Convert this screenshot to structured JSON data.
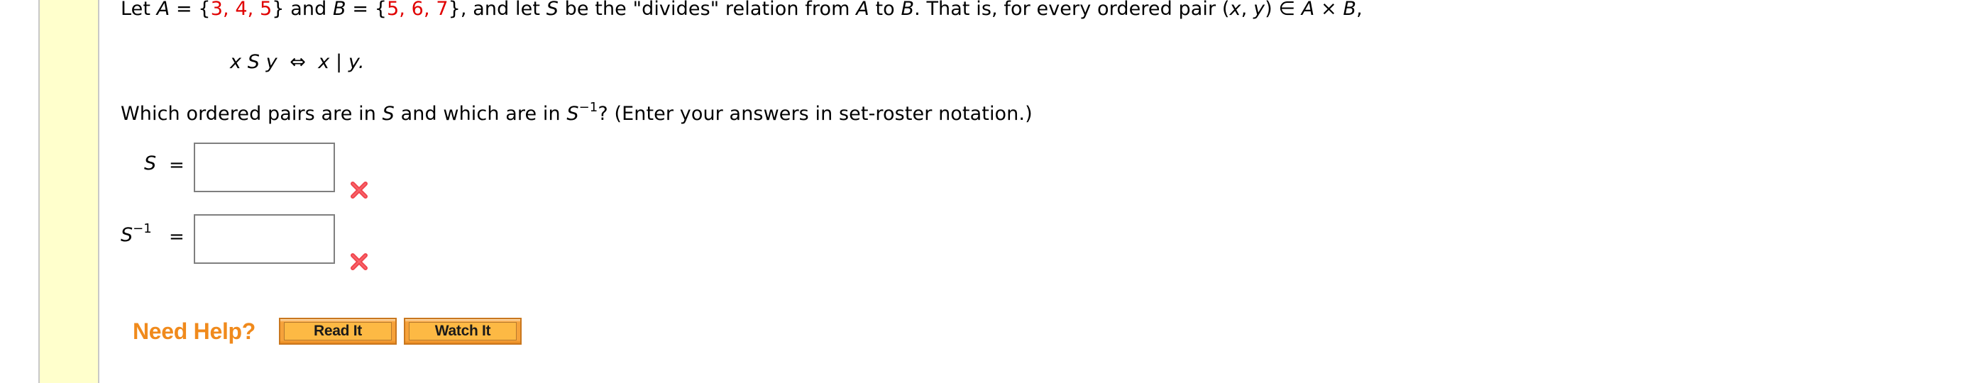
{
  "problem": {
    "line1": {
      "let": "Let ",
      "A": "A",
      "eq1": " = {",
      "A_elements": "3, 4, 5",
      "close1": "} and ",
      "B": "B",
      "eq2": " = {",
      "B_elements": "5, 6, 7",
      "close2": "}, and let ",
      "S": "S",
      "rest1": " be the \"divides\" relation from ",
      "A2": "A",
      "to": " to ",
      "B2": "B",
      "rest2": ". That is, for every ordered pair (",
      "x": "x",
      "comma": ", ",
      "y": "y",
      "rest3": ") ∈ ",
      "A3": "A",
      "times": " × ",
      "B3": "B",
      "end": ","
    },
    "definition": {
      "lhs": "x S y",
      "iff": "⇔",
      "rhs": "x | y."
    },
    "question": {
      "part1": "Which ordered pairs are in ",
      "S": "S",
      "part2": " and which are in ",
      "S2": "S",
      "exponent": "−1",
      "part3": "? (Enter your answers in set-roster notation.)"
    }
  },
  "answers": [
    {
      "label": "S",
      "exponent": "",
      "equals": "=",
      "value": "",
      "status": "incorrect",
      "status_icon": "x-mark-icon"
    },
    {
      "label": "S",
      "exponent": "−1",
      "equals": "=",
      "value": "",
      "status": "incorrect",
      "status_icon": "x-mark-icon"
    }
  ],
  "help": {
    "label": "Need Help?",
    "buttons": [
      {
        "label": "Read It"
      },
      {
        "label": "Watch It"
      }
    ]
  },
  "colors": {
    "sidebar": "#ffffcc",
    "set_elements": "#e00000",
    "need_help": "#f08a1c",
    "button_fill": "#fdb944",
    "incorrect_mark": "#f0454d"
  }
}
